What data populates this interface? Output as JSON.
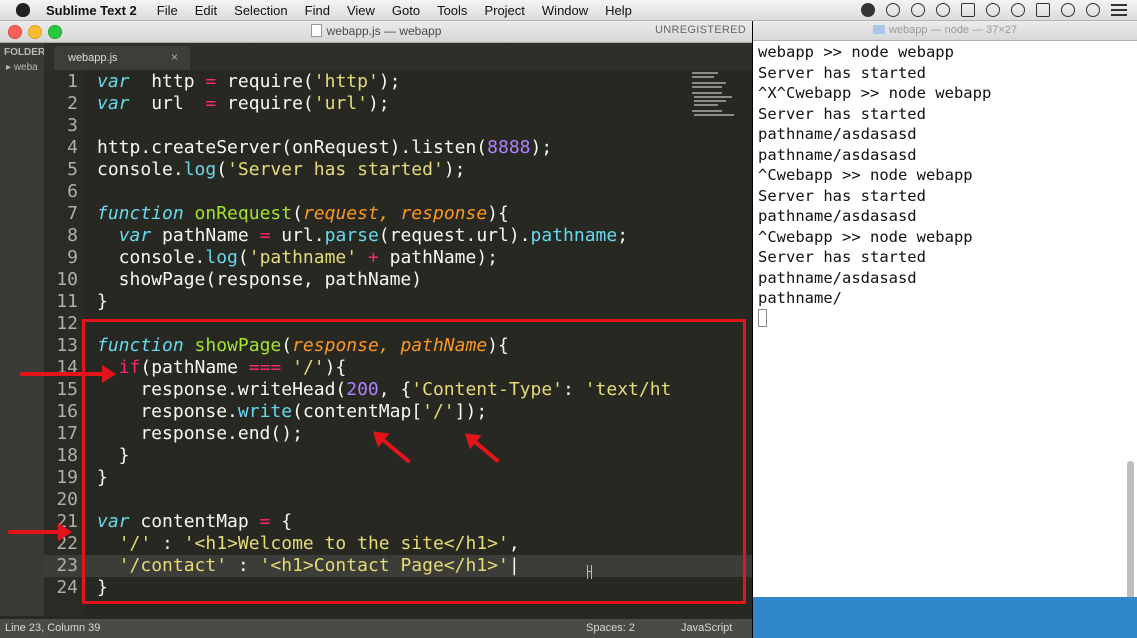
{
  "menubar": {
    "app_name": "Sublime Text 2",
    "items": [
      "File",
      "Edit",
      "Selection",
      "Find",
      "View",
      "Goto",
      "Tools",
      "Project",
      "Window",
      "Help"
    ]
  },
  "editor": {
    "window_title": "webapp.js — webapp",
    "unregistered": "UNREGISTERED",
    "sidebar_header": "FOLDER",
    "sidebar_item": "weba",
    "tab_name": "webapp.js",
    "tab_close": "×",
    "lines": [
      {
        "n": "1",
        "segs": [
          [
            "k",
            "var"
          ],
          [
            "",
            "  http "
          ],
          [
            "kw",
            "="
          ],
          [
            "",
            " require("
          ],
          [
            "s",
            "'http'"
          ],
          [
            "",
            ");"
          ]
        ]
      },
      {
        "n": "2",
        "segs": [
          [
            "k",
            "var"
          ],
          [
            "",
            "  url  "
          ],
          [
            "kw",
            "="
          ],
          [
            "",
            " require("
          ],
          [
            "s",
            "'url'"
          ],
          [
            "",
            ");"
          ]
        ]
      },
      {
        "n": "3",
        "segs": []
      },
      {
        "n": "4",
        "segs": [
          [
            "",
            "http.createServer(onRequest).listen("
          ],
          [
            "num",
            "8888"
          ],
          [
            "",
            ");"
          ]
        ]
      },
      {
        "n": "5",
        "segs": [
          [
            "",
            "console."
          ],
          [
            "pr",
            "log"
          ],
          [
            "",
            "("
          ],
          [
            "s",
            "'Server has started'"
          ],
          [
            "",
            ");"
          ]
        ]
      },
      {
        "n": "6",
        "segs": []
      },
      {
        "n": "7",
        "segs": [
          [
            "k",
            "function"
          ],
          [
            "",
            " "
          ],
          [
            "fn",
            "onRequest"
          ],
          [
            "",
            "("
          ],
          [
            "p",
            "request, response"
          ],
          [
            "",
            "){"
          ]
        ]
      },
      {
        "n": "8",
        "segs": [
          [
            "",
            "  "
          ],
          [
            "k",
            "var"
          ],
          [
            "",
            " pathName "
          ],
          [
            "kw",
            "="
          ],
          [
            "",
            " url."
          ],
          [
            "pr",
            "parse"
          ],
          [
            "",
            "(request.url)."
          ],
          [
            "pr",
            "pathname"
          ],
          [
            "",
            ";"
          ]
        ]
      },
      {
        "n": "9",
        "segs": [
          [
            "",
            "  console."
          ],
          [
            "pr",
            "log"
          ],
          [
            "",
            "("
          ],
          [
            "s",
            "'pathname'"
          ],
          [
            "",
            " "
          ],
          [
            "kw",
            "+"
          ],
          [
            "",
            " pathName);"
          ]
        ]
      },
      {
        "n": "10",
        "segs": [
          [
            "",
            "  showPage(response, pathName)"
          ]
        ]
      },
      {
        "n": "11",
        "segs": [
          [
            "",
            "}"
          ]
        ]
      },
      {
        "n": "12",
        "segs": []
      },
      {
        "n": "13",
        "segs": [
          [
            "k",
            "function"
          ],
          [
            "",
            " "
          ],
          [
            "fn",
            "showPage"
          ],
          [
            "",
            "("
          ],
          [
            "p",
            "response, pathName"
          ],
          [
            "",
            "){"
          ]
        ]
      },
      {
        "n": "14",
        "segs": [
          [
            "",
            "  "
          ],
          [
            "kw",
            "if"
          ],
          [
            "",
            "(pathName "
          ],
          [
            "kw",
            "==="
          ],
          [
            "",
            " "
          ],
          [
            "s",
            "'/'"
          ],
          [
            "",
            "){"
          ]
        ]
      },
      {
        "n": "15",
        "segs": [
          [
            "",
            "    response.writeHead("
          ],
          [
            "num",
            "200"
          ],
          [
            "",
            ", {"
          ],
          [
            "s",
            "'Content-Type'"
          ],
          [
            "",
            ": "
          ],
          [
            "s",
            "'text/ht"
          ]
        ]
      },
      {
        "n": "16",
        "segs": [
          [
            "",
            "    response."
          ],
          [
            "pr",
            "write"
          ],
          [
            "",
            "(contentMap["
          ],
          [
            "s",
            "'/'"
          ],
          [
            "",
            "]);"
          ]
        ]
      },
      {
        "n": "17",
        "segs": [
          [
            "",
            "    response.end();"
          ]
        ]
      },
      {
        "n": "18",
        "segs": [
          [
            "",
            "  }"
          ]
        ]
      },
      {
        "n": "19",
        "segs": [
          [
            "",
            "}"
          ]
        ]
      },
      {
        "n": "20",
        "segs": []
      },
      {
        "n": "21",
        "segs": [
          [
            "k",
            "var"
          ],
          [
            "",
            " contentMap "
          ],
          [
            "kw",
            "="
          ],
          [
            "",
            " {"
          ]
        ]
      },
      {
        "n": "22",
        "segs": [
          [
            "",
            "  "
          ],
          [
            "s",
            "'/'"
          ],
          [
            "",
            " : "
          ],
          [
            "s",
            "'<h1>Welcome to the site</h1>'"
          ],
          [
            "",
            ","
          ]
        ]
      },
      {
        "n": "23",
        "segs": [
          [
            "",
            "  "
          ],
          [
            "s",
            "'/contact'"
          ],
          [
            "",
            " : "
          ],
          [
            "s",
            "'<h1>Contact Page</h1>'"
          ],
          [
            "",
            "|"
          ]
        ]
      },
      {
        "n": "24",
        "segs": [
          [
            "",
            "}"
          ]
        ]
      }
    ],
    "current_line": 23,
    "status_position": "Line 23, Column 39",
    "status_spaces": "Spaces: 2",
    "status_syntax": "JavaScript"
  },
  "terminal": {
    "title": "webapp — node — 37×27",
    "lines": [
      "webapp >> node webapp",
      "Server has started",
      "^X^Cwebapp >> node webapp",
      "Server has started",
      "pathname/asdasasd",
      "pathname/asdasasd",
      "^Cwebapp >> node webapp",
      "Server has started",
      "pathname/asdasasd",
      "^Cwebapp >> node webapp",
      "Server has started",
      "pathname/asdasasd",
      "pathname/"
    ]
  },
  "colors": {
    "annotation_red": "#e5141b",
    "editor_bg": "#272822",
    "terminal_bg": "#ffffff"
  }
}
